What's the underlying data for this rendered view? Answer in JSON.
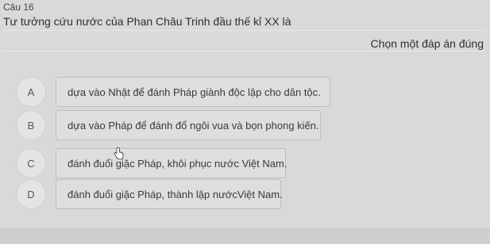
{
  "question": {
    "number": "Câu 16",
    "text": "Tư tưởng cứu nước của Phan Châu Trinh đầu thế kỉ XX là",
    "instruction": "Chọn một đáp án đúng"
  },
  "options": [
    {
      "letter": "A",
      "text": "dựa vào Nhật để đánh Pháp giành độc lập cho dân tộc."
    },
    {
      "letter": "B",
      "text": "dựa vào Pháp để đánh đổ ngôi vua và bọn phong kiến."
    },
    {
      "letter": "C",
      "text": "đánh đuổi giặc Pháp, khôi phục nước Việt Nam."
    },
    {
      "letter": "D",
      "text": "đánh đuổi giặc Pháp, thành lập nướcViệt Nam."
    }
  ],
  "colors": {
    "background": "#d9d9d9",
    "option_box": "#dedede",
    "option_border": "#bdbdbd"
  },
  "icons": {
    "cursor": "hand-pointer-icon"
  }
}
